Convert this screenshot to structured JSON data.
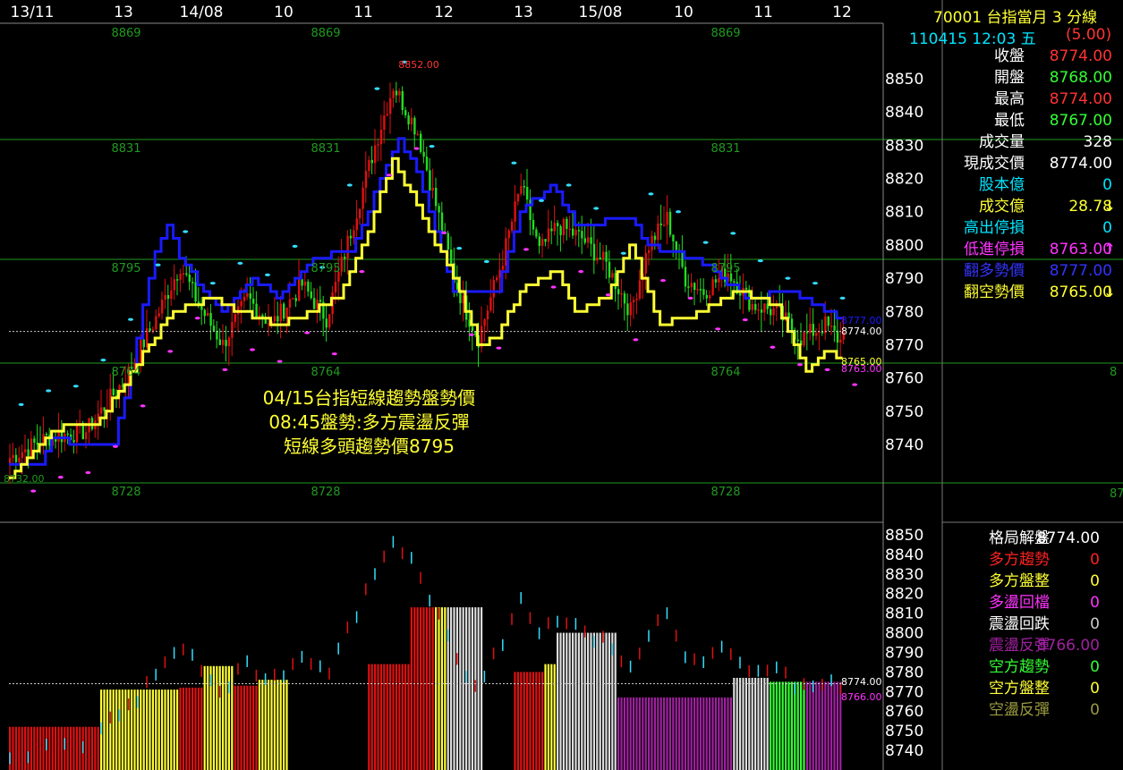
{
  "x_axis": {
    "labels": [
      "13/11",
      "13",
      "14/08",
      "10",
      "11",
      "12",
      "13",
      "15/08",
      "10",
      "11",
      "12"
    ]
  },
  "header": {
    "code": "70001",
    "name": "台指當月",
    "period": "3 分線",
    "datetime": "110415 12:03 五",
    "change": "(5.00)"
  },
  "quote": [
    {
      "label": "收盤",
      "value": "8774.00",
      "color": "#ff3333"
    },
    {
      "label": "開盤",
      "value": "8768.00",
      "color": "#33ff33"
    },
    {
      "label": "最高",
      "value": "8774.00",
      "color": "#ff3333"
    },
    {
      "label": "最低",
      "value": "8767.00",
      "color": "#33ff33"
    },
    {
      "label": "成交量",
      "value": "328",
      "color": "#ffffff"
    },
    {
      "label": "現成交價",
      "value": "8774.00",
      "color": "#ffffff"
    },
    {
      "label": "股本億",
      "value": "0",
      "color": "#00e5ff",
      "label_color": "#00e5ff"
    },
    {
      "label": "成交億",
      "value": "28.78",
      "color": "#ffff33",
      "label_color": "#ffff33",
      "arrow": "↓"
    },
    {
      "label": "高出停損",
      "value": "0",
      "color": "#00e5ff",
      "label_color": "#00e5ff"
    },
    {
      "label": "低進停損",
      "value": "8763.00",
      "color": "#ff33ff",
      "label_color": "#ff33ff",
      "arrow": "↑"
    },
    {
      "label": "翻多勢價",
      "value": "8777.00",
      "color": "#3333ff",
      "label_color": "#3333ff"
    },
    {
      "label": "翻空勢價",
      "value": "8765.00",
      "color": "#ffff33",
      "label_color": "#ffff33",
      "arrow": "↓"
    }
  ],
  "pattern": [
    {
      "label": "格局解盤",
      "value": "8774.00",
      "color": "#ffffff",
      "label_color": "#ffffff"
    },
    {
      "label": "多方趨勢",
      "value": "0",
      "color": "#ff2222",
      "label_color": "#ff2222"
    },
    {
      "label": "多方盤整",
      "value": "0",
      "color": "#ffff33",
      "label_color": "#ffff33"
    },
    {
      "label": "多盪回檔",
      "value": "0",
      "color": "#ff33ff",
      "label_color": "#ff33ff"
    },
    {
      "label": "震盪回跌",
      "value": "0",
      "color": "#cccccc",
      "label_color": "#ffffff"
    },
    {
      "label": "震盪反彈",
      "value": "8766.00",
      "color": "#a020a0",
      "label_color": "#a020a0"
    },
    {
      "label": "空方趨勢",
      "value": "0",
      "color": "#33ff33",
      "label_color": "#33ff33"
    },
    {
      "label": "空方盤整",
      "value": "0",
      "color": "#ffff33",
      "label_color": "#ffff33"
    },
    {
      "label": "空盪反彈",
      "value": "0",
      "color": "#9a9a40",
      "label_color": "#9a9a40"
    }
  ],
  "annotation": [
    "04/15台指短線趨勢盤勢價",
    "08:45盤勢:多方震盪反彈",
    "短線多頭趨勢價8795"
  ],
  "levels": [
    {
      "value": 8869,
      "label": "8869"
    },
    {
      "value": 8831,
      "label": "8831"
    },
    {
      "value": 8795,
      "label": "8795"
    },
    {
      "value": 8764,
      "label": "8764"
    },
    {
      "value": 8728,
      "label": "8728"
    }
  ],
  "markers": {
    "high": "8852.00",
    "left": "8732.00",
    "blue": "8777.00",
    "red": "8774.00",
    "yellow": "8765.00",
    "magenta": "8763.00",
    "lower_white": "8774.00",
    "lower_purple": "8766.00"
  },
  "upper_axis": [
    "8850",
    "8840",
    "8830",
    "8820",
    "8810",
    "8800",
    "8790",
    "8780",
    "8770",
    "8760",
    "8750",
    "8740"
  ],
  "lower_axis": [
    "8850",
    "8840",
    "8830",
    "8820",
    "8810",
    "8800",
    "8790",
    "8780",
    "8770",
    "8760",
    "8750",
    "8740"
  ],
  "right_edge": [
    "8",
    "87"
  ],
  "colors": {
    "up": "#e01010",
    "down": "#22dd22",
    "blue_line": "#1a1aff",
    "yellow_line": "#ffff33",
    "level": "#1f9a1f",
    "cyan": "#33ddff",
    "magenta": "#ff33ff"
  },
  "chart_data": {
    "type": "candlestick",
    "price_range": [
      8732,
      8852
    ],
    "last": 8774,
    "keypoints": [
      [
        0,
        8736
      ],
      [
        12,
        8742
      ],
      [
        25,
        8744
      ],
      [
        38,
        8760
      ],
      [
        48,
        8778
      ],
      [
        56,
        8794
      ],
      [
        62,
        8782
      ],
      [
        70,
        8770
      ],
      [
        78,
        8784
      ],
      [
        86,
        8776
      ],
      [
        96,
        8788
      ],
      [
        104,
        8778
      ],
      [
        112,
        8804
      ],
      [
        120,
        8830
      ],
      [
        126,
        8848
      ],
      [
        134,
        8834
      ],
      [
        140,
        8812
      ],
      [
        146,
        8790
      ],
      [
        150,
        8780
      ],
      [
        154,
        8772
      ],
      [
        162,
        8796
      ],
      [
        168,
        8818
      ],
      [
        174,
        8798
      ],
      [
        180,
        8806
      ],
      [
        188,
        8802
      ],
      [
        196,
        8794
      ],
      [
        204,
        8780
      ],
      [
        210,
        8800
      ],
      [
        216,
        8808
      ],
      [
        222,
        8790
      ],
      [
        228,
        8786
      ],
      [
        236,
        8792
      ],
      [
        244,
        8782
      ],
      [
        252,
        8780
      ],
      [
        260,
        8772
      ],
      [
        268,
        8776
      ],
      [
        274,
        8770
      ]
    ],
    "blue_line": [
      [
        0,
        8734
      ],
      [
        10,
        8734
      ],
      [
        14,
        8742
      ],
      [
        24,
        8740
      ],
      [
        34,
        8740
      ],
      [
        40,
        8762
      ],
      [
        44,
        8782
      ],
      [
        48,
        8798
      ],
      [
        52,
        8806
      ],
      [
        56,
        8796
      ],
      [
        64,
        8786
      ],
      [
        70,
        8780
      ],
      [
        80,
        8790
      ],
      [
        88,
        8784
      ],
      [
        100,
        8796
      ],
      [
        112,
        8798
      ],
      [
        128,
        8832
      ],
      [
        134,
        8822
      ],
      [
        146,
        8786
      ],
      [
        160,
        8786
      ],
      [
        168,
        8810
      ],
      [
        178,
        8818
      ],
      [
        186,
        8806
      ],
      [
        204,
        8808
      ],
      [
        210,
        8800
      ],
      [
        224,
        8796
      ],
      [
        232,
        8792
      ],
      [
        242,
        8784
      ],
      [
        256,
        8786
      ],
      [
        268,
        8780
      ],
      [
        274,
        8778
      ]
    ],
    "yellow_line": [
      [
        0,
        8730
      ],
      [
        14,
        8744
      ],
      [
        20,
        8746
      ],
      [
        28,
        8746
      ],
      [
        38,
        8758
      ],
      [
        44,
        8768
      ],
      [
        54,
        8780
      ],
      [
        66,
        8784
      ],
      [
        76,
        8780
      ],
      [
        88,
        8776
      ],
      [
        96,
        8778
      ],
      [
        108,
        8784
      ],
      [
        118,
        8804
      ],
      [
        126,
        8826
      ],
      [
        146,
        8790
      ],
      [
        154,
        8770
      ],
      [
        160,
        8772
      ],
      [
        168,
        8786
      ],
      [
        180,
        8792
      ],
      [
        186,
        8780
      ],
      [
        196,
        8784
      ],
      [
        204,
        8800
      ],
      [
        214,
        8776
      ],
      [
        222,
        8778
      ],
      [
        232,
        8782
      ],
      [
        240,
        8786
      ],
      [
        252,
        8782
      ],
      [
        262,
        8762
      ],
      [
        268,
        8768
      ],
      [
        274,
        8765
      ]
    ]
  }
}
